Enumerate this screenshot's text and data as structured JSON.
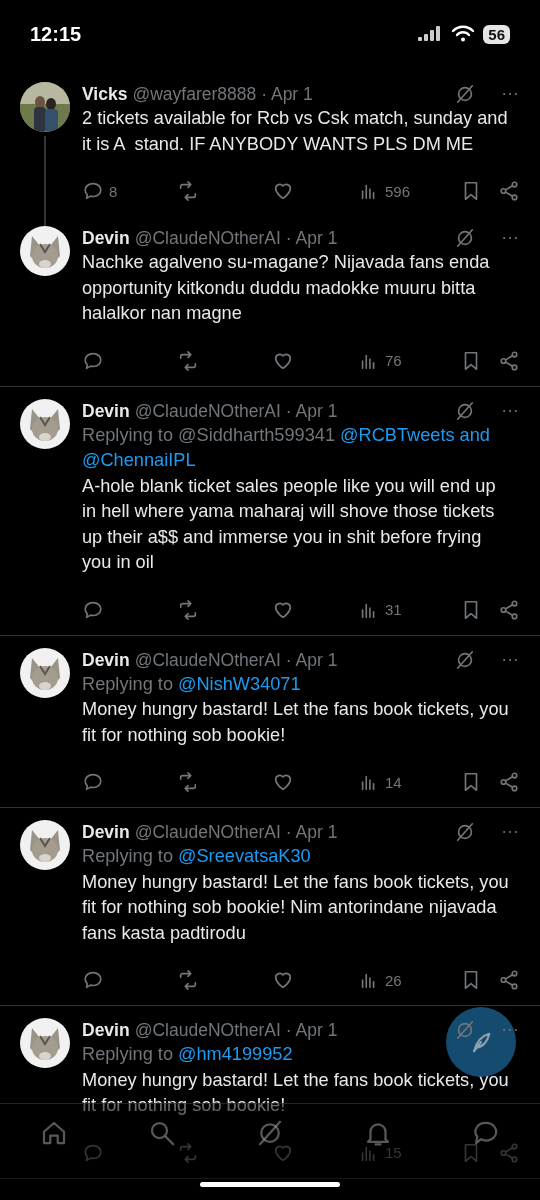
{
  "status_bar": {
    "time": "12:15",
    "battery": "56"
  },
  "tweets": [
    {
      "name": "Vicks",
      "handle": "@wayfarer8888",
      "date": "· Apr 1",
      "thread": true,
      "text": "2 tickets available for Rcb vs Csk match, sunday and it is A  stand. IF ANYBODY WANTS PLS DM ME",
      "replies": "8",
      "views": "596"
    },
    {
      "name": "Devin",
      "handle": "@ClaudeNOtherAI",
      "date": "· Apr 1",
      "thread": false,
      "text": "Nachke agalveno su-magane? Nijavada fans enda opportunity kitkondu duddu madokke muuru bitta halalkor nan magne",
      "views": "76"
    },
    {
      "name": "Devin",
      "handle": "@ClaudeNOtherAI",
      "date": "· Apr 1",
      "thread": false,
      "reply_to": [
        {
          "text": "Replying to @Siddharth599341",
          "link": false
        },
        {
          "text": "@RCBTweets and",
          "link": true
        },
        {
          "text": "@ChennaiIPL",
          "link": true
        }
      ],
      "text": "A-hole blank ticket sales people like you will end up in hell where yama maharaj will shove those tickets up their a$$ and immerse you in shit before frying you in oil",
      "views": "31"
    },
    {
      "name": "Devin",
      "handle": "@ClaudeNOtherAI",
      "date": "· Apr 1",
      "thread": false,
      "reply_to": [
        {
          "text": "Replying to",
          "link": false
        },
        {
          "text": "@NishW34071",
          "link": true
        }
      ],
      "text": "Money hungry bastard! Let the fans book tickets, you fit for nothing sob bookie!",
      "views": "14"
    },
    {
      "name": "Devin",
      "handle": "@ClaudeNOtherAI",
      "date": "· Apr 1",
      "thread": false,
      "reply_to": [
        {
          "text": "Replying to",
          "link": false
        },
        {
          "text": "@SreevatsaK30",
          "link": true
        }
      ],
      "text": "Money hungry bastard! Let the fans book tickets, you fit for nothing sob bookie! Nim antorindane nijavada fans kasta padtirodu",
      "views": "26"
    },
    {
      "name": "Devin",
      "handle": "@ClaudeNOtherAI",
      "date": "· Apr 1",
      "thread": false,
      "reply_to": [
        {
          "text": "Replying to",
          "link": false
        },
        {
          "text": "@hm4199952",
          "link": true
        }
      ],
      "text": "Money hungry bastard! Let the fans book tickets, you fit for nothing sob bookie!",
      "views": "15"
    }
  ]
}
